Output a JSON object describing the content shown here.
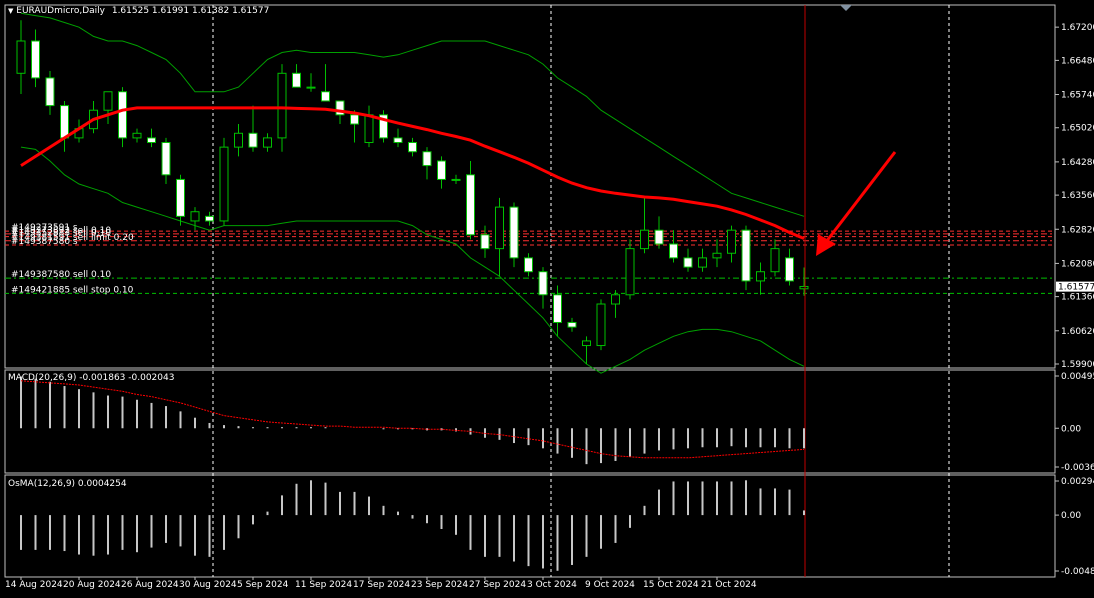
{
  "main": {
    "symbol_label": "EURAUDmicro,Daily",
    "ohlc": "1.61525 1.61991 1.61382 1.61577",
    "price_labels": [
      "1.67200",
      "1.66480",
      "1.65740",
      "1.65020",
      "1.64280",
      "1.63560",
      "1.62820",
      "1.62080",
      "1.61360",
      "1.60620",
      "1.59900"
    ],
    "current_price": "1.61577",
    "order_labels": [
      {
        "text": "#149273591 s",
        "price": 1.6278
      },
      {
        "text": "#149273892 sell 0.10",
        "price": 1.6272
      },
      {
        "text": "#149352883 sell 0.10",
        "price": 1.6266
      },
      {
        "text": "#149381591 sell limit 0.20",
        "price": 1.6257
      },
      {
        "text": "#149387580 s",
        "price": 1.6248
      },
      {
        "text": "#149387580 sell 0.10",
        "price": 1.6176
      },
      {
        "text": "#149421885 sell stop 0.10",
        "price": 1.6143
      }
    ]
  },
  "macd": {
    "label": "MACD(20,26,9) -0.001863 -0.002043",
    "scale_labels": [
      "0.00495",
      "0.00",
      "-0.00367"
    ]
  },
  "osma": {
    "label": "OsMA(12,26,9) 0.0004254",
    "scale_labels": [
      "0.00294",
      "0.00",
      "-0.00482"
    ]
  },
  "date_labels": [
    "14 Aug 2024",
    "20 Aug 2024",
    "26 Aug 2024",
    "30 Aug 2024",
    "5 Sep 2024",
    "11 Sep 2024",
    "17 Sep 2024",
    "23 Sep 2024",
    "27 Sep 2024",
    "3 Oct 2024",
    "9 Oct 2024",
    "15 Oct 2024",
    "21 Oct 2024"
  ],
  "colors": {
    "background": "#000000",
    "bull_candle": "#000000",
    "bear_candle": "#ffffff",
    "wick": "#00c000",
    "moving_average": "#ff0000",
    "bollinger": "#00a000",
    "order_line_red": "#ff3030",
    "order_line_green": "#00c000",
    "arrow": "#ff0000",
    "histogram": "#c8c8c8",
    "signal_line": "#ff0000"
  },
  "chart_data": {
    "type": "candlestick",
    "timeframe": "Daily",
    "candles": [
      [
        1.662,
        1.6735,
        1.6575,
        1.669
      ],
      [
        1.669,
        1.6715,
        1.659,
        1.661
      ],
      [
        1.661,
        1.6625,
        1.653,
        1.655
      ],
      [
        1.655,
        1.656,
        1.645,
        1.648
      ],
      [
        1.648,
        1.652,
        1.647,
        1.65
      ],
      [
        1.65,
        1.656,
        1.649,
        1.654
      ],
      [
        1.654,
        1.658,
        1.651,
        1.658
      ],
      [
        1.658,
        1.659,
        1.646,
        1.648
      ],
      [
        1.648,
        1.65,
        1.647,
        1.649
      ],
      [
        1.648,
        1.65,
        1.646,
        1.647
      ],
      [
        1.647,
        1.648,
        1.638,
        1.64
      ],
      [
        1.639,
        1.64,
        1.629,
        1.631
      ],
      [
        1.63,
        1.633,
        1.628,
        1.632
      ],
      [
        1.631,
        1.632,
        1.629,
        1.63
      ],
      [
        1.63,
        1.648,
        1.629,
        1.646
      ],
      [
        1.646,
        1.651,
        1.644,
        1.649
      ],
      [
        1.649,
        1.655,
        1.645,
        1.646
      ],
      [
        1.646,
        1.649,
        1.645,
        1.648
      ],
      [
        1.648,
        1.664,
        1.645,
        1.662
      ],
      [
        1.662,
        1.664,
        1.659,
        1.659
      ],
      [
        1.659,
        1.662,
        1.658,
        1.659
      ],
      [
        1.658,
        1.664,
        1.656,
        1.656
      ],
      [
        1.656,
        1.656,
        1.651,
        1.653
      ],
      [
        1.653,
        1.654,
        1.647,
        1.651
      ],
      [
        1.647,
        1.655,
        1.646,
        1.653
      ],
      [
        1.653,
        1.654,
        1.647,
        1.648
      ],
      [
        1.648,
        1.65,
        1.646,
        1.647
      ],
      [
        1.647,
        1.648,
        1.644,
        1.645
      ],
      [
        1.645,
        1.646,
        1.639,
        1.642
      ],
      [
        1.643,
        1.644,
        1.637,
        1.639
      ],
      [
        1.639,
        1.64,
        1.638,
        1.639
      ],
      [
        1.64,
        1.643,
        1.626,
        1.627
      ],
      [
        1.627,
        1.629,
        1.622,
        1.624
      ],
      [
        1.624,
        1.635,
        1.618,
        1.633
      ],
      [
        1.633,
        1.634,
        1.62,
        1.622
      ],
      [
        1.622,
        1.623,
        1.618,
        1.619
      ],
      [
        1.619,
        1.62,
        1.611,
        1.614
      ],
      [
        1.614,
        1.616,
        1.605,
        1.608
      ],
      [
        1.608,
        1.609,
        1.606,
        1.607
      ],
      [
        1.603,
        1.605,
        1.599,
        1.604
      ],
      [
        1.603,
        1.613,
        1.602,
        1.612
      ],
      [
        1.612,
        1.615,
        1.609,
        1.614
      ],
      [
        1.614,
        1.626,
        1.613,
        1.624
      ],
      [
        1.624,
        1.635,
        1.623,
        1.628
      ],
      [
        1.628,
        1.631,
        1.624,
        1.625
      ],
      [
        1.625,
        1.628,
        1.621,
        1.622
      ],
      [
        1.622,
        1.624,
        1.619,
        1.62
      ],
      [
        1.62,
        1.624,
        1.619,
        1.622
      ],
      [
        1.622,
        1.626,
        1.62,
        1.623
      ],
      [
        1.623,
        1.629,
        1.621,
        1.628
      ],
      [
        1.628,
        1.629,
        1.615,
        1.617
      ],
      [
        1.617,
        1.621,
        1.614,
        1.619
      ],
      [
        1.619,
        1.626,
        1.618,
        1.624
      ],
      [
        1.622,
        1.624,
        1.616,
        1.617
      ],
      [
        1.6153,
        1.6199,
        1.6138,
        1.6158
      ]
    ],
    "moving_average": [
      1.642,
      1.644,
      1.646,
      1.648,
      1.65,
      1.652,
      1.653,
      1.654,
      1.6545,
      1.6545,
      1.6545,
      1.6545,
      1.6545,
      1.6545,
      1.6545,
      1.6545,
      1.6545,
      1.6545,
      1.6545,
      1.6544,
      1.6543,
      1.6542,
      1.6538,
      1.6534,
      1.6528,
      1.652,
      1.6512,
      1.6505,
      1.6498,
      1.649,
      1.6483,
      1.6475,
      1.6462,
      1.645,
      1.6438,
      1.6425,
      1.641,
      1.6395,
      1.6382,
      1.6372,
      1.6365,
      1.636,
      1.6356,
      1.6352,
      1.635,
      1.6347,
      1.6342,
      1.6337,
      1.6332,
      1.6324,
      1.6314,
      1.6302,
      1.629,
      1.6275,
      1.6262
    ],
    "bollinger_upper": [
      1.675,
      1.6745,
      1.674,
      1.673,
      1.672,
      1.67,
      1.669,
      1.669,
      1.668,
      1.6665,
      1.665,
      1.662,
      1.658,
      1.658,
      1.658,
      1.659,
      1.662,
      1.665,
      1.6665,
      1.667,
      1.6665,
      1.6665,
      1.6665,
      1.6665,
      1.666,
      1.6655,
      1.666,
      1.667,
      1.668,
      1.669,
      1.669,
      1.669,
      1.669,
      1.668,
      1.667,
      1.666,
      1.664,
      1.661,
      1.659,
      1.657,
      1.654,
      1.652,
      1.65,
      1.648,
      1.646,
      1.644,
      1.642,
      1.64,
      1.638,
      1.636,
      1.635,
      1.634,
      1.633,
      1.632,
      1.631
    ],
    "bollinger_lower": [
      1.646,
      1.6455,
      1.643,
      1.64,
      1.638,
      1.637,
      1.636,
      1.634,
      1.633,
      1.632,
      1.631,
      1.63,
      1.629,
      1.628,
      1.629,
      1.629,
      1.629,
      1.629,
      1.6295,
      1.63,
      1.63,
      1.63,
      1.63,
      1.63,
      1.63,
      1.63,
      1.63,
      1.629,
      1.627,
      1.626,
      1.625,
      1.622,
      1.62,
      1.618,
      1.615,
      1.612,
      1.609,
      1.605,
      1.602,
      1.599,
      1.597,
      1.5985,
      1.6,
      1.602,
      1.6035,
      1.605,
      1.606,
      1.6065,
      1.6065,
      1.606,
      1.605,
      1.604,
      1.602,
      1.6,
      1.5985
    ],
    "macd_hist": [
      0.0049,
      0.0047,
      0.0044,
      0.004,
      0.0037,
      0.0034,
      0.0031,
      0.003,
      0.0027,
      0.0024,
      0.0021,
      0.0016,
      0.001,
      0.0005,
      0.0003,
      0.0002,
      0.0001,
      0.0001,
      0.0001,
      0.0001,
      0.0001,
      0.0001,
      0.0,
      0.0,
      0.0,
      -0.0001,
      -0.0001,
      -0.0001,
      -0.0002,
      -0.0002,
      -0.0003,
      -0.0006,
      -0.0009,
      -0.0011,
      -0.0014,
      -0.0016,
      -0.0019,
      -0.0024,
      -0.0028,
      -0.0034,
      -0.0033,
      -0.0031,
      -0.0027,
      -0.0024,
      -0.0021,
      -0.002,
      -0.0019,
      -0.0018,
      -0.0018,
      -0.0017,
      -0.0018,
      -0.0018,
      -0.0018,
      -0.0019,
      -0.0019
    ],
    "macd_signal": [
      0.0045,
      0.0044,
      0.0043,
      0.0042,
      0.0041,
      0.0039,
      0.0037,
      0.0035,
      0.0032,
      0.003,
      0.0027,
      0.0024,
      0.002,
      0.0016,
      0.0012,
      0.001,
      0.0008,
      0.0006,
      0.0005,
      0.0004,
      0.0003,
      0.0002,
      0.0002,
      0.0001,
      0.0001,
      0.0001,
      0.0,
      0.0,
      -0.0001,
      -0.0001,
      -0.0002,
      -0.0003,
      -0.0005,
      -0.0006,
      -0.0008,
      -0.001,
      -0.0012,
      -0.0015,
      -0.0018,
      -0.0021,
      -0.0024,
      -0.0026,
      -0.0027,
      -0.0028,
      -0.0028,
      -0.0028,
      -0.0028,
      -0.0027,
      -0.0026,
      -0.0025,
      -0.0024,
      -0.0023,
      -0.0022,
      -0.0021,
      -0.002
    ],
    "osma_hist": [
      -0.003,
      -0.003,
      -0.003,
      -0.0031,
      -0.0034,
      -0.0035,
      -0.0034,
      -0.003,
      -0.0032,
      -0.0028,
      -0.0024,
      -0.0027,
      -0.0035,
      -0.0036,
      -0.003,
      -0.002,
      -0.0008,
      0.0003,
      0.0017,
      0.0027,
      0.003,
      0.0028,
      0.002,
      0.002,
      0.0016,
      0.0008,
      0.0003,
      -0.0003,
      -0.0007,
      -0.0012,
      -0.0017,
      -0.003,
      -0.0036,
      -0.0036,
      -0.004,
      -0.0044,
      -0.0046,
      -0.0048,
      -0.0043,
      -0.0036,
      -0.0029,
      -0.0024,
      -0.0011,
      0.0008,
      0.0022,
      0.0029,
      0.0029,
      0.0029,
      0.0029,
      0.0029,
      0.003,
      0.0023,
      0.0023,
      0.0022,
      0.0004
    ],
    "price_range": [
      1.599,
      1.6755
    ],
    "macd_range": [
      -0.00367,
      0.00495
    ],
    "osma_range": [
      -0.00482,
      0.00294
    ],
    "grid": false
  }
}
